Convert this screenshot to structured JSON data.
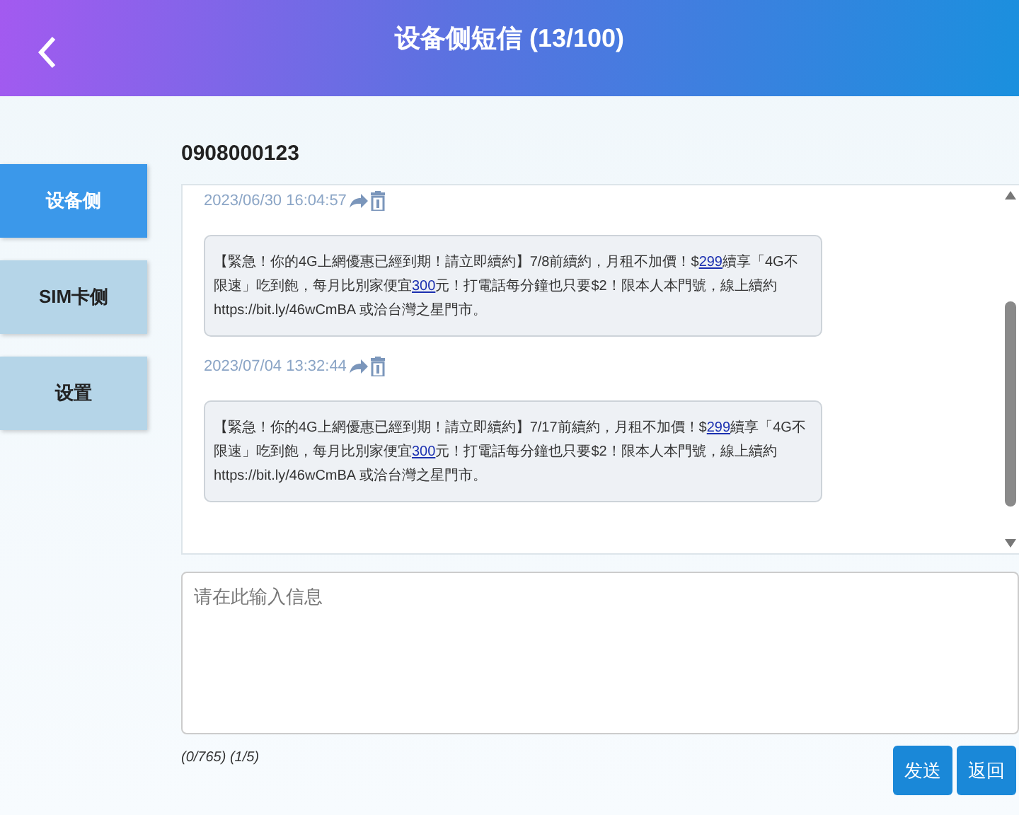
{
  "header": {
    "title": "设备侧短信 (13/100)"
  },
  "sidebar": {
    "items": [
      {
        "label": "设备侧",
        "selected": true
      },
      {
        "label": "SIM卡侧",
        "selected": false
      },
      {
        "label": "设置",
        "selected": false
      }
    ]
  },
  "contact": "0908000123",
  "messages": [
    {
      "time": "2023/06/30 16:04:57",
      "segments": [
        {
          "kind": "text",
          "text": "【緊急！你的4G上網優惠已經到期！請立即續約】7/8前續約，月租不加價！$"
        },
        {
          "kind": "link",
          "text": "299"
        },
        {
          "kind": "text",
          "text": "續享「4G不限速」吃到飽，每月比別家便宜"
        },
        {
          "kind": "link",
          "text": "300"
        },
        {
          "kind": "text",
          "text": "元！打電話每分鐘也只要$2！限本人本門號，線上續約 https://bit.ly/46wCmBA 或洽台灣之星門市。"
        }
      ]
    },
    {
      "time": "2023/07/04 13:32:44",
      "segments": [
        {
          "kind": "text",
          "text": "【緊急！你的4G上網優惠已經到期！請立即續約】7/17前續約，月租不加價！$"
        },
        {
          "kind": "link",
          "text": "299"
        },
        {
          "kind": "text",
          "text": "續享「4G不限速」吃到飽，每月比別家便宜"
        },
        {
          "kind": "link",
          "text": "300"
        },
        {
          "kind": "text",
          "text": "元！打電話每分鐘也只要$2！限本人本門號，線上續約 https://bit.ly/46wCmBA 或洽台灣之星門市。"
        }
      ]
    }
  ],
  "composer": {
    "placeholder": "请在此输入信息",
    "counter": "(0/765) (1/5)"
  },
  "buttons": [
    {
      "label": "发送"
    },
    {
      "label": "返回"
    }
  ]
}
